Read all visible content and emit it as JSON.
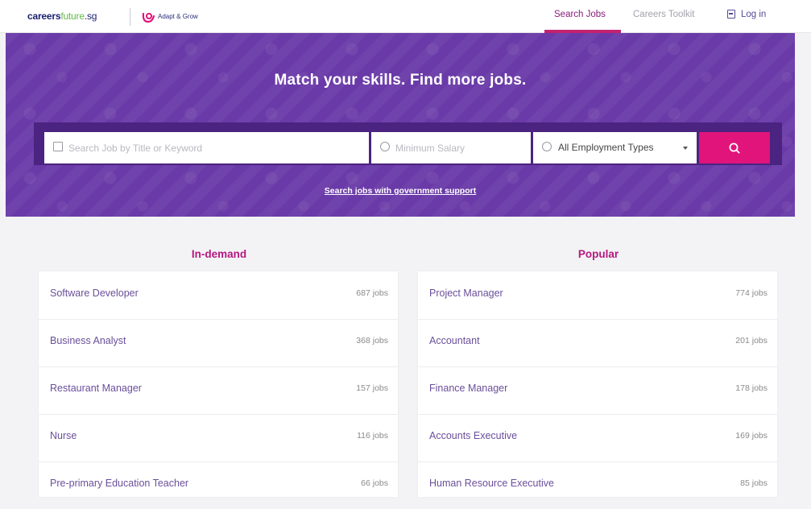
{
  "header": {
    "logo_careersfuture": [
      "careers",
      "future",
      ".sg"
    ],
    "logo_adapt_grow": "Adapt & Grow",
    "nav": [
      {
        "label": "Search Jobs",
        "active": true
      },
      {
        "label": "Careers Toolkit",
        "active": false
      },
      {
        "label": "Log in",
        "active": false
      }
    ]
  },
  "hero": {
    "title": "Match your skills. Find more jobs.",
    "search": {
      "keyword_placeholder": "Search Job by Title or Keyword",
      "keyword_value": "",
      "salary_placeholder": "Minimum Salary",
      "salary_value": "",
      "employment_type_selected": "All Employment Types"
    },
    "gov_support_link": "Search jobs with government support"
  },
  "in_demand": {
    "title": "In-demand",
    "items": [
      {
        "label": "Software Developer",
        "count": "687 jobs"
      },
      {
        "label": "Business Analyst",
        "count": "368 jobs"
      },
      {
        "label": "Restaurant Manager",
        "count": "157 jobs"
      },
      {
        "label": "Nurse",
        "count": "116 jobs"
      },
      {
        "label": "Pre-primary Education Teacher",
        "count": "66 jobs"
      }
    ]
  },
  "popular": {
    "title": "Popular",
    "items": [
      {
        "label": "Project Manager",
        "count": "774 jobs"
      },
      {
        "label": "Accountant",
        "count": "201 jobs"
      },
      {
        "label": "Finance Manager",
        "count": "178 jobs"
      },
      {
        "label": "Accounts Executive",
        "count": "169 jobs"
      },
      {
        "label": "Human Resource Executive",
        "count": "85 jobs"
      }
    ]
  },
  "colors": {
    "hero_bg": "#6a3aa8",
    "search_button": "#e0147b",
    "accent_pink": "#b5177f",
    "nav_active": "#8a1c7c",
    "link_purple": "#6a4f9a"
  },
  "icons": [
    "briefcase-icon",
    "dollar-icon",
    "clock-icon",
    "search-icon",
    "login-icon",
    "adapt-grow-logo-icon"
  ]
}
